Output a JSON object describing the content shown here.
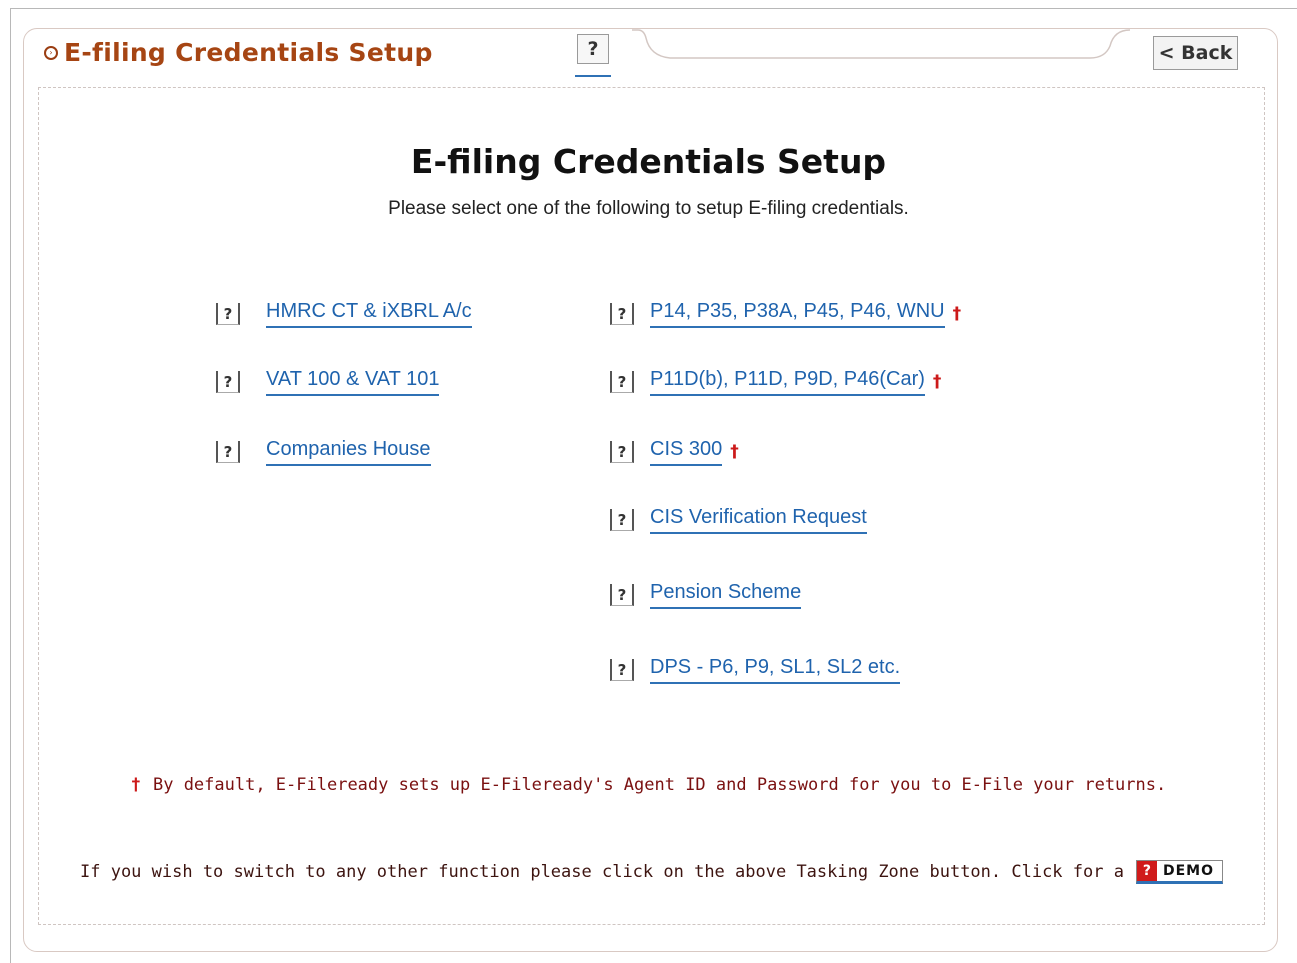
{
  "header": {
    "title": "E-filing Credentials Setup",
    "help_label": "?",
    "back_label": "< Back"
  },
  "main": {
    "title": "E-filing Credentials Setup",
    "subtitle": "Please select one of the following to setup E-filing credentials.",
    "left_items": [
      {
        "help": "?",
        "label": "HMRC CT & iXBRL A/c",
        "dagger": ""
      },
      {
        "help": "?",
        "label": "VAT 100 & VAT 101",
        "dagger": ""
      },
      {
        "help": "?",
        "label": "Companies House",
        "dagger": ""
      }
    ],
    "right_items": [
      {
        "help": "?",
        "label": "P14, P35, P38A, P45, P46, WNU",
        "dagger": "†"
      },
      {
        "help": "?",
        "label": "P11D(b), P11D, P9D, P46(Car)",
        "dagger": "†"
      },
      {
        "help": "?",
        "label": "CIS 300",
        "dagger": "†"
      },
      {
        "help": "?",
        "label": "CIS Verification Request",
        "dagger": ""
      },
      {
        "help": "?",
        "label": "Pension Scheme",
        "dagger": ""
      },
      {
        "help": "?",
        "label": "DPS - P6, P9, SL1, SL2 etc.",
        "dagger": ""
      }
    ],
    "note_dagger": "†",
    "note_text": "By default, E-Fileready sets up E-Fileready's Agent ID and Password for you to E-File your returns.",
    "switch_text": "If you wish to switch to any other function please click on the above Tasking Zone button. Click for a",
    "demo": {
      "icon": "?",
      "label": "DEMO"
    }
  },
  "colors": {
    "header_title": "#a64513",
    "link": "#1f63ad",
    "dagger": "#cc1a1a",
    "note_text": "#7a1010"
  }
}
